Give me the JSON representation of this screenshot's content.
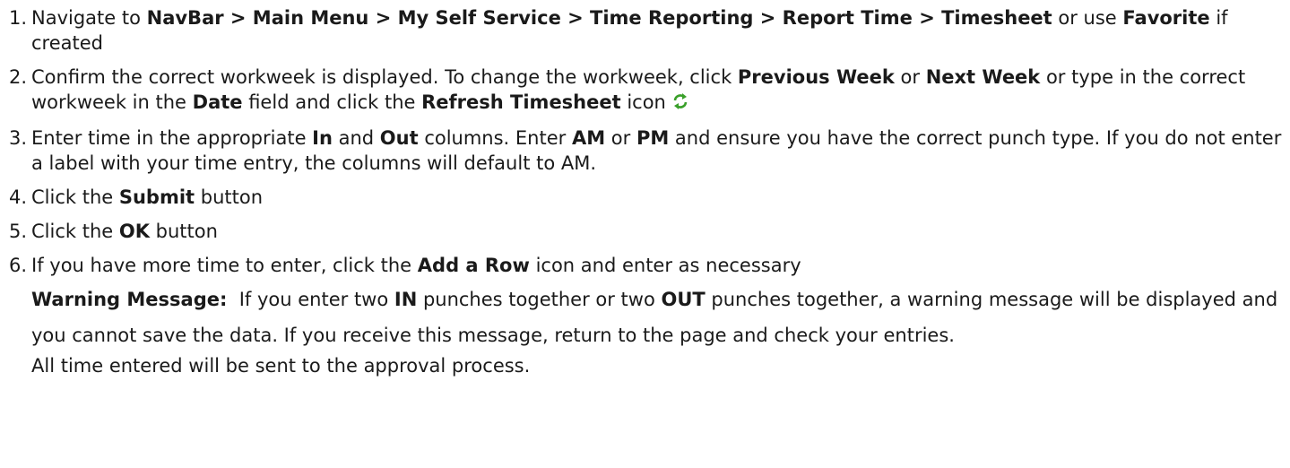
{
  "steps": [
    {
      "num": "1.",
      "t1": "Navigate to ",
      "b1": "NavBar > Main Menu > My Self Service > Time Reporting > Report Time > Timesheet",
      "t2": " or use ",
      "b2": "Favorite",
      "t3": " if created"
    },
    {
      "num": "2.",
      "t1": "Confirm the correct workweek is displayed.  To change the workweek, click ",
      "b1": "Previous Week",
      "t2": " or ",
      "b2": "Next Week",
      "t3": " or type in the correct workweek in the ",
      "b3": "Date",
      "t4": " field and click the ",
      "b4": "Refresh Timesheet",
      "t5": " icon",
      "icon": "refresh-icon"
    },
    {
      "num": "3.",
      "t1": "Enter time in the appropriate ",
      "b1": "In",
      "t2": " and ",
      "b2": "Out",
      "t3": " columns.  Enter ",
      "b3": "AM",
      "t4": " or ",
      "b4": "PM",
      "t5": " and ensure you have the correct punch type.  If you do not enter a label with your time entry, the columns will default to AM."
    },
    {
      "num": "4.",
      "t1": "Click the ",
      "b1": "Submit",
      "t2": " button"
    },
    {
      "num": "5.",
      "t1": "Click the ",
      "b1": "OK",
      "t2": " button"
    },
    {
      "num": "6.",
      "t1": "If you have more time to enter, click the ",
      "b1": "Add a Row",
      "t2": " icon and enter as necessary"
    }
  ],
  "warning": {
    "label": "Warning Message:",
    "t1": "  If you enter two ",
    "b1": "IN",
    "t2": " punches together or two ",
    "b2": "OUT",
    "t3": " punches together, a warning message will be displayed and you cannot save the data.  If you receive this message, return to the page and check your entries."
  },
  "footer_note": "All time entered will be sent to the approval process.",
  "colors": {
    "text": "#1a1a1a",
    "icon_green": "#3aa02a"
  }
}
